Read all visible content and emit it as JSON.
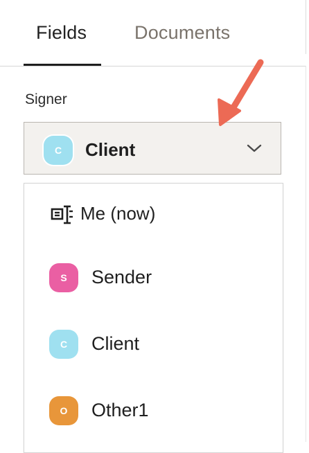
{
  "tabs": [
    {
      "label": "Fields",
      "active": true
    },
    {
      "label": "Documents",
      "active": false
    }
  ],
  "signer": {
    "label": "Signer",
    "selected": {
      "initial": "C",
      "name": "Client",
      "color": "#9fe0f0"
    }
  },
  "dropdown": {
    "options": [
      {
        "label": "Me (now)",
        "icon": "text-cursor-field-icon"
      },
      {
        "initial": "S",
        "label": "Sender",
        "color": "#ea5fa3"
      },
      {
        "initial": "C",
        "label": "Client",
        "color": "#9fe0f0"
      },
      {
        "initial": "O",
        "label": "Other1",
        "color": "#e8963a"
      }
    ]
  },
  "annotation": {
    "arrow_color": "#ec6a55"
  }
}
